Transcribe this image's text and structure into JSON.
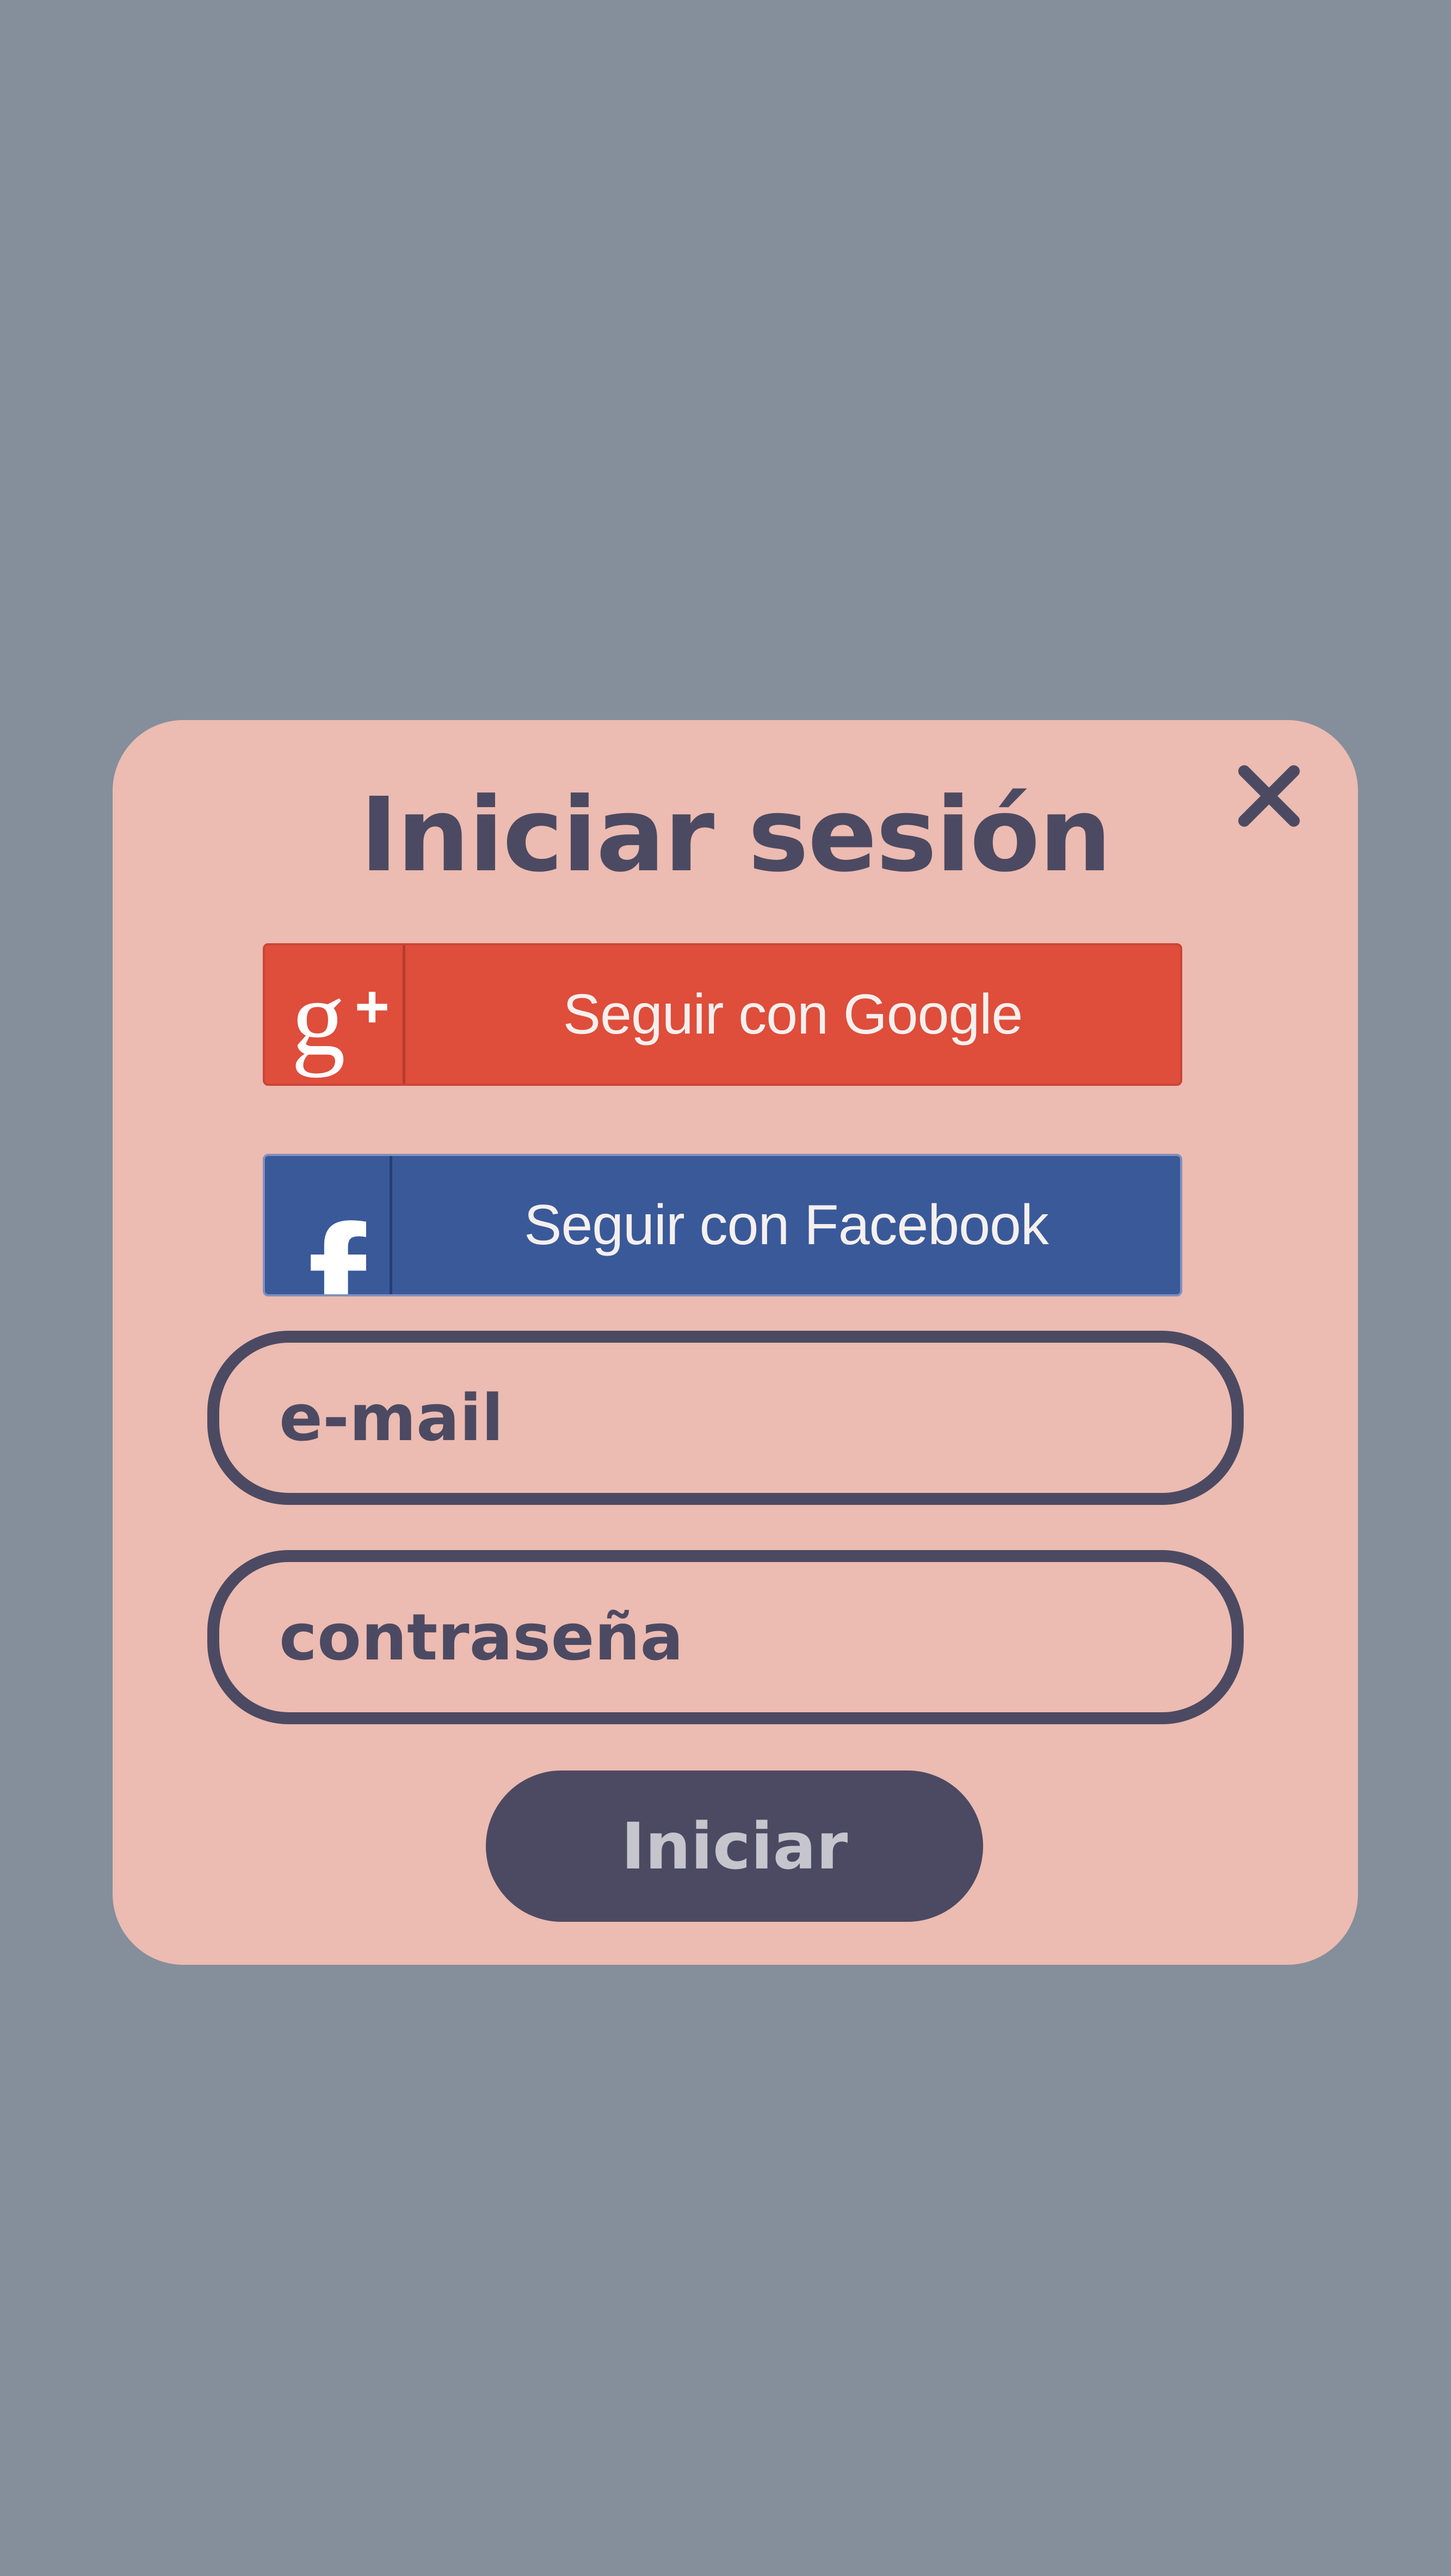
{
  "modal": {
    "title": "Iniciar sesión",
    "close_icon": "close-icon"
  },
  "social": {
    "google": {
      "label": "Seguir con Google",
      "icon": "google-plus-icon",
      "color": "#df4d3b"
    },
    "facebook": {
      "label": "Seguir con Facebook",
      "icon": "facebook-icon",
      "color": "#3a5999"
    }
  },
  "form": {
    "email": {
      "placeholder": "e-mail",
      "value": ""
    },
    "password": {
      "placeholder": "contraseña",
      "value": ""
    },
    "submit_label": "Iniciar"
  },
  "colors": {
    "background": "#848f9b",
    "modal": "#ecbbb1",
    "accent": "#4c4a62",
    "button_text": "#c6c4cc"
  }
}
